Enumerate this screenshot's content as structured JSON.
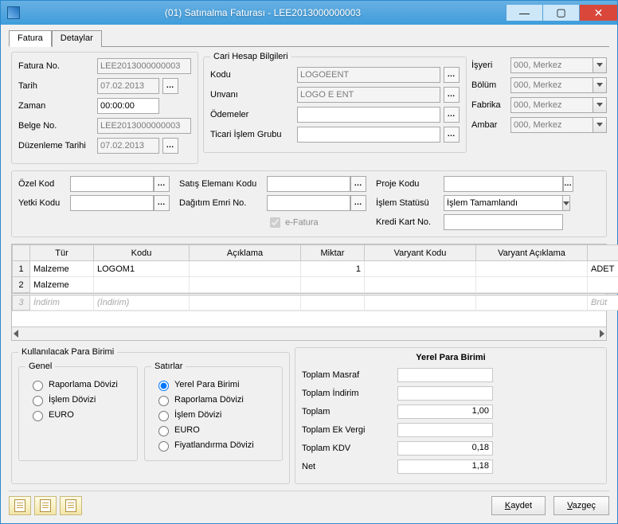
{
  "window": {
    "title": "(01) Satınalma Faturası - LEE2013000000003"
  },
  "tabs": {
    "fatura": "Fatura",
    "detaylar": "Detaylar"
  },
  "invoice": {
    "faturaNoLabel": "Fatura No.",
    "faturaNo": "LEE2013000000003",
    "tarihLabel": "Tarih",
    "tarih": "07.02.2013",
    "zamanLabel": "Zaman",
    "zaman": "00:00:00",
    "belgeNoLabel": "Belge No.",
    "belgeNo": "LEE2013000000003",
    "duzenlemeTarihiLabel": "Düzenleme Tarihi",
    "duzenlemeTarihi": "07.02.2013"
  },
  "cari": {
    "legend": "Cari Hesap Bilgileri",
    "koduLabel": "Kodu",
    "kodu": "LOGOEENT",
    "unvaniLabel": "Unvanı",
    "unvani": "LOGO E ENT",
    "odemelerLabel": "Ödemeler",
    "odemeler": "",
    "ticariIslemGrubuLabel": "Ticari İşlem Grubu",
    "ticariIslemGrubu": ""
  },
  "org": {
    "isyeriLabel": "İşyeri",
    "isyeri": "000, Merkez",
    "bolumLabel": "Bölüm",
    "bolum": "000, Merkez",
    "fabrikaLabel": "Fabrika",
    "fabrika": "000, Merkez",
    "ambarLabel": "Ambar",
    "ambar": "000, Merkez"
  },
  "codes": {
    "ozelKodLabel": "Özel Kod",
    "ozelKod": "",
    "yetkiKoduLabel": "Yetki Kodu",
    "yetkiKodu": "",
    "satisElemaniKoduLabel": "Satış Elemanı Kodu",
    "satisElemaniKodu": "",
    "dagitimEmriNoLabel": "Dağıtım Emri No.",
    "dagitimEmriNo": "",
    "eFaturaLabel": "e-Fatura",
    "projeKoduLabel": "Proje Kodu",
    "projeKodu": "",
    "islemStatusuLabel": "İşlem Statüsü",
    "islemStatusu": "İşlem Tamamlandı",
    "krediKartNoLabel": "Kredi Kart No.",
    "krediKartNo": ""
  },
  "gridHeaders": {
    "tur": "Tür",
    "kodu": "Kodu",
    "aciklama": "Açıklama",
    "miktar": "Miktar",
    "varyantKodu": "Varyant Kodu",
    "varyantAciklama": "Varyant Açıklama",
    "birim": ""
  },
  "gridRows": [
    {
      "n": "1",
      "tur": "Malzeme",
      "kodu": "LOGOM1",
      "aciklama": "",
      "miktar": "1",
      "varyantKodu": "",
      "varyantAciklama": "",
      "birim": "ADET"
    },
    {
      "n": "2",
      "tur": "Malzeme",
      "kodu": "",
      "aciklama": "",
      "miktar": "",
      "varyantKodu": "",
      "varyantAciklama": "",
      "birim": ""
    }
  ],
  "gridRows2": [
    {
      "n": "3",
      "tur": "İndirim",
      "kodu": "(İndirim)",
      "aciklama": "",
      "miktar": "",
      "varyantKodu": "",
      "varyantAciklama": "",
      "birim": "Brüt"
    }
  ],
  "currency": {
    "legendMain": "Kullanılacak Para Birimi",
    "legendGenel": "Genel",
    "raporlamaDovizi": "Raporlama Dövizi",
    "islemDovizi": "İşlem Dövizi",
    "euro": "EURO",
    "legendSatirlar": "Satırlar",
    "yerelParaBirimi": "Yerel Para Birimi",
    "fiyatlandirmaDovizi": "Fiyatlandırma Dövizi"
  },
  "totals": {
    "legend": "Yerel Para Birimi",
    "toplamMasrafLabel": "Toplam Masraf",
    "toplamMasraf": "",
    "toplamIndirimLabel": "Toplam İndirim",
    "toplamIndirim": "",
    "toplamLabel": "Toplam",
    "toplam": "1,00",
    "toplamEkVergiLabel": "Toplam Ek Vergi",
    "toplamEkVergi": "",
    "toplamKdvLabel": "Toplam KDV",
    "toplamKdv": "0,18",
    "netLabel": "Net",
    "net": "1,18"
  },
  "buttons": {
    "kaydet": "Kaydet",
    "vazgec": "Vazgeç"
  }
}
